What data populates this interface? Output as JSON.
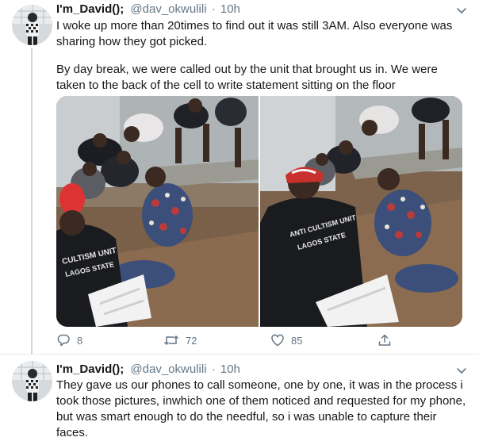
{
  "tweets": [
    {
      "author_name": "I'm_David();",
      "handle": "@dav_okwulili",
      "separator": "·",
      "time": "10h",
      "paragraphs": [
        "I woke up more than 20times to find out it was still 3AM. Also everyone was sharing how they got picked.",
        "By day break, we were called out by the unit that brought us in. We were taken to the back of the cell to write statement sitting on the floor"
      ],
      "photos": [
        {
          "shirt_print": [
            "CULTISM UNIT",
            "LAGOS STATE"
          ]
        },
        {
          "shirt_print": [
            "ANTI CULTISM UNIT",
            "LAGOS STATE"
          ]
        }
      ],
      "stats": {
        "replies": "8",
        "retweets": "72",
        "likes": "85"
      }
    },
    {
      "author_name": "I'm_David();",
      "handle": "@dav_okwulili",
      "separator": "·",
      "time": "10h",
      "paragraphs": [
        "They gave us our phones to call someone, one by one, it was in the process i took those pictures, inwhich one of them noticed and requested for my phone, but was smart enough to do the needful, so i was unable to capture their faces."
      ]
    }
  ],
  "icons": {
    "reply": "reply-icon",
    "retweet": "retweet-icon",
    "like": "heart-icon",
    "share": "share-icon",
    "more": "chevron-down-icon"
  },
  "colors": {
    "text": "#14171a",
    "secondary": "#657786",
    "divider": "#e6ecf0",
    "thread_line": "#ccd6dd"
  }
}
